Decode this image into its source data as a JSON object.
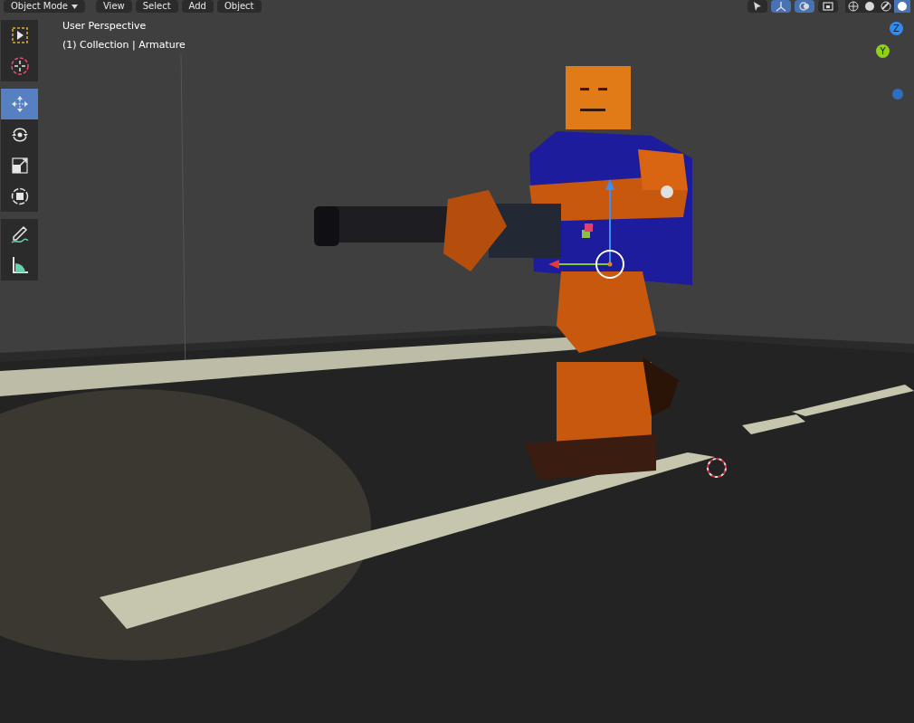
{
  "header": {
    "mode_menu": "Object Mode",
    "menus": [
      "View",
      "Select",
      "Add",
      "Object"
    ],
    "toggles": [
      {
        "kind": "select",
        "selected": false
      },
      {
        "kind": "gizmo",
        "selected": true
      },
      {
        "kind": "overlay",
        "selected": true
      },
      {
        "kind": "xray",
        "selected": false
      }
    ],
    "shading": [
      {
        "kind": "wire",
        "selected": false
      },
      {
        "kind": "solid",
        "selected": false
      },
      {
        "kind": "material",
        "selected": false
      },
      {
        "kind": "rendered",
        "selected": true
      }
    ]
  },
  "viewport": {
    "view_name": "User Perspective",
    "context": "(1) Collection | Armature"
  },
  "tools": [
    {
      "kind": "select",
      "selected": false
    },
    {
      "kind": "cursor",
      "selected": false
    },
    {
      "kind": "move",
      "selected": true
    },
    {
      "kind": "rotate",
      "selected": false
    },
    {
      "kind": "scale",
      "selected": false
    },
    {
      "kind": "transform",
      "selected": false
    },
    {
      "kind": "annotate",
      "selected": false
    },
    {
      "kind": "measure",
      "selected": false
    }
  ],
  "gizmo": {
    "axes": [
      {
        "label": "Z",
        "color": "#2f8cf0"
      },
      {
        "label": "Y",
        "color": "#8ed11c"
      }
    ]
  }
}
